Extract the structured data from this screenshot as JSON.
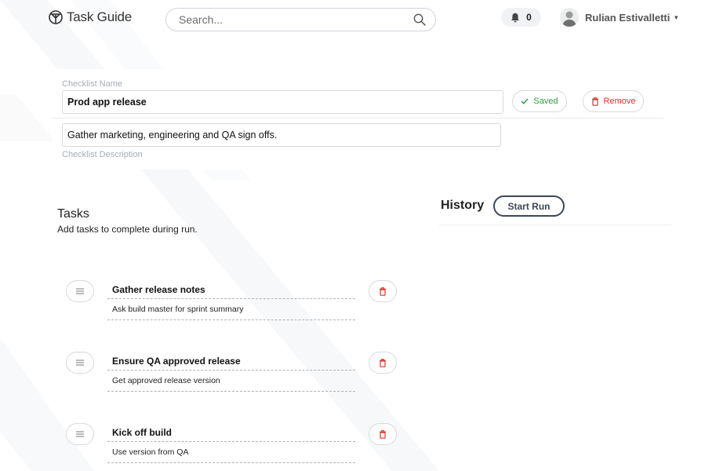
{
  "header": {
    "app_name": "Task Guide",
    "search_placeholder": "Search...",
    "notification_count": "0",
    "user_name": "Rulian Estivalletti"
  },
  "checklist": {
    "name_label": "Checklist Name",
    "name_value": "Prod app release",
    "description_value": "Gather marketing, engineering and QA sign offs.",
    "description_label": "Checklist Description",
    "saved_label": "Saved",
    "remove_label": "Remove"
  },
  "tasks_section": {
    "title": "Tasks",
    "subtitle": "Add tasks to complete during run.",
    "items": [
      {
        "title": "Gather release notes",
        "description": "Ask build master for sprint summary"
      },
      {
        "title": "Ensure QA approved release",
        "description": "Get approved release version"
      },
      {
        "title": "Kick off build",
        "description": "Use version from QA"
      }
    ]
  },
  "history_section": {
    "title": "History",
    "start_run_label": "Start Run"
  },
  "colors": {
    "saved_green": "#2f9e44",
    "remove_red": "#d9342b",
    "button_dark": "#3d4757"
  },
  "icons": {
    "logo": "logo-icon",
    "search": "search-icon",
    "notification": "bell-icon",
    "drag": "drag-handle-icon",
    "delete": "trash-icon",
    "saved": "check-icon"
  }
}
